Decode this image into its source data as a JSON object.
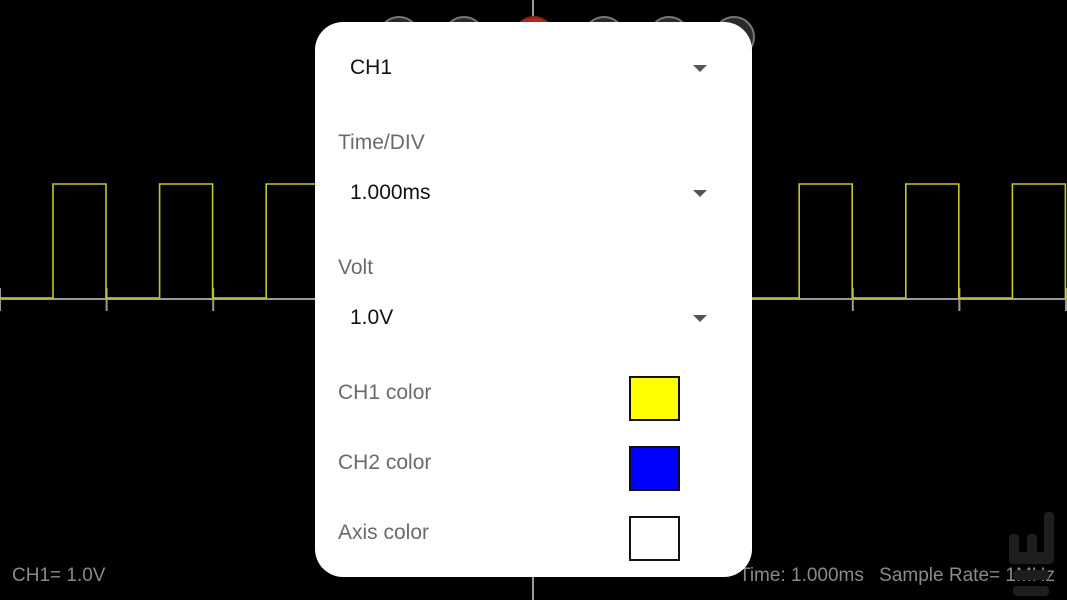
{
  "colors": {
    "background": "#000000",
    "ch1_trace": "#c9c62a",
    "axis": "#9a9a9a",
    "dialog_bg": "#ffffff",
    "record_button": "#b3261e"
  },
  "status": {
    "channel_volt": "CH1= 1.0V",
    "time": "Time: 1.000ms",
    "sample_rate": "Sample Rate= 1MHz"
  },
  "dialog": {
    "channel": {
      "value": "CH1"
    },
    "time_div": {
      "label": "Time/DIV",
      "value": "1.000ms"
    },
    "volt": {
      "label": "Volt",
      "value": "1.0V"
    },
    "ch1_color": {
      "label": "CH1 color",
      "color": "#ffff00"
    },
    "ch2_color": {
      "label": "CH2 color",
      "color": "#0000ff"
    },
    "axis_color": {
      "label": "Axis color",
      "color": "#ffffff"
    }
  },
  "icons": {
    "dropdown": "triangle-down",
    "watermark": "app-logo"
  }
}
